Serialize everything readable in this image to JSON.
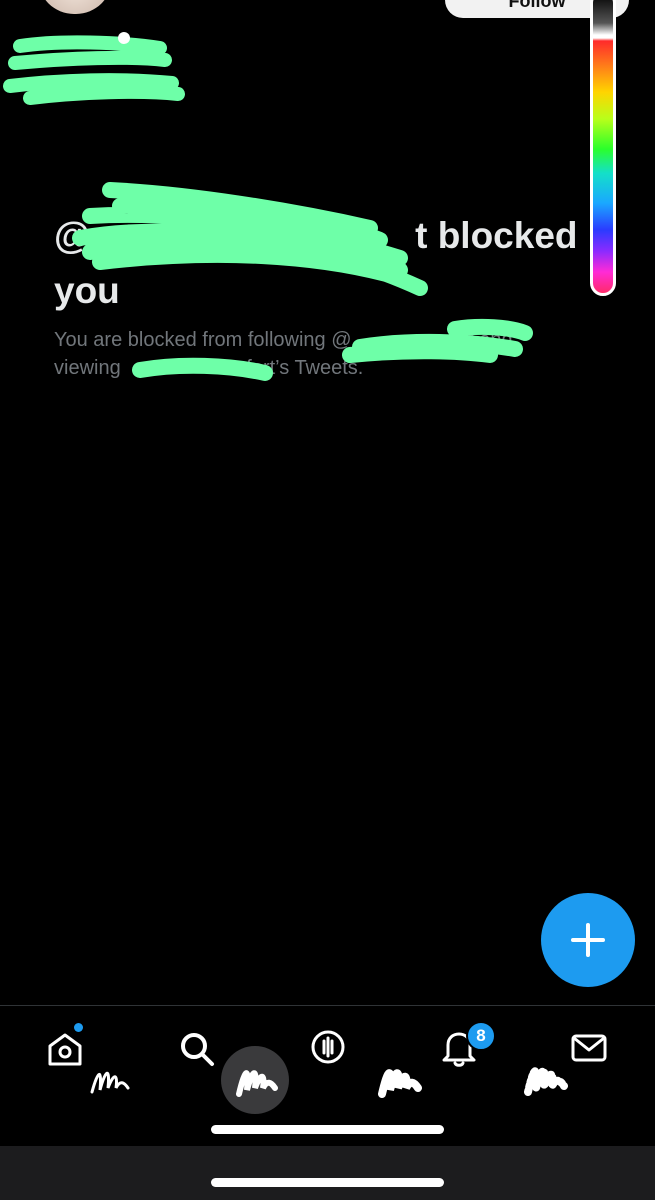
{
  "header": {
    "follow_label": "Follow"
  },
  "blocked": {
    "handle_prefix": "@",
    "handle_suffix": "t",
    "title_rest": " blocked you",
    "line1_prefix": "You are blocked from following @",
    "line1_suffix": "rt and",
    "line2_prefix": "viewing ",
    "line2_suffix": "fort’s Tweets."
  },
  "tabbar": {
    "notifications_badge": "8",
    "icons": [
      "home-icon",
      "search-icon",
      "spaces-icon",
      "notifications-icon",
      "messages-icon"
    ]
  },
  "colors": {
    "background": "#000000",
    "accent": "#1d9bf0",
    "redaction": "#6effa8",
    "muted_text": "#71767b"
  }
}
